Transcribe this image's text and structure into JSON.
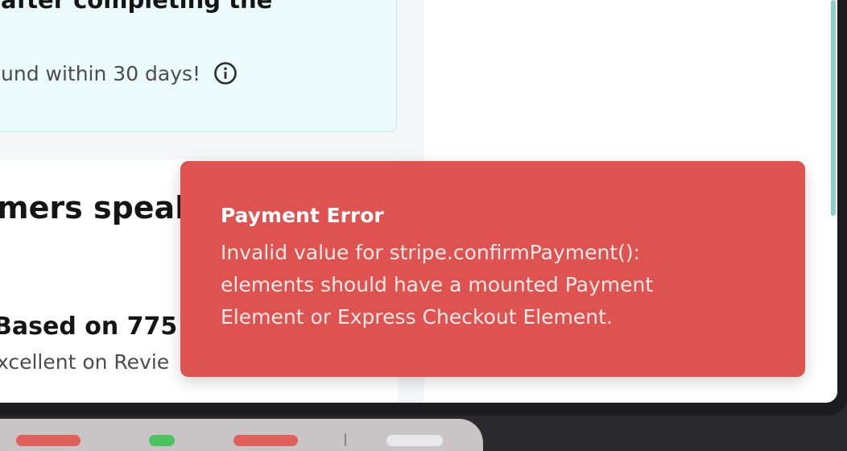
{
  "guarantee": {
    "heading": "after completing the",
    "refund_text": "und within 30 days!",
    "info_icon": "info-circle-icon"
  },
  "reviews": {
    "heading": "mers speak",
    "count_text": "Based on 775 r",
    "rating_text": "xcellent on Revie"
  },
  "toast": {
    "title": "Payment Error",
    "message": "Invalid value for stripe.confirmPayment(): elements should have a mounted Payment Element or Express Checkout Element.",
    "background": "#de524f"
  },
  "colors": {
    "guarantee_bg": "#ebfbfb",
    "guarantee_border": "#bfeee9",
    "scrollbar": "#8fcfcb"
  }
}
